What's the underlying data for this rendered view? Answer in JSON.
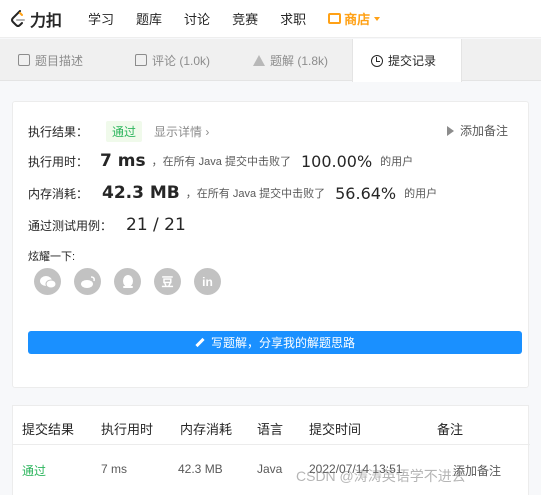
{
  "nav": {
    "brand": "力扣",
    "items": [
      "学习",
      "题库",
      "讨论",
      "竞赛",
      "求职"
    ],
    "store": "商店"
  },
  "tabs": [
    {
      "label": "题目描述",
      "icon": "document-icon"
    },
    {
      "label": "评论 (1.0k)",
      "icon": "comment-icon"
    },
    {
      "label": "题解 (1.8k)",
      "icon": "flask-icon"
    },
    {
      "label": "提交记录",
      "icon": "clock-icon",
      "active": true
    }
  ],
  "result": {
    "status_label": "执行结果：",
    "status_value": "通过",
    "show_detail": "显示详情 ›",
    "add_note": "添加备注",
    "runtime_label": "执行用时：",
    "runtime_value": "7 ms",
    "runtime_beat_text": "，在所有 Java 提交中击败了",
    "runtime_pct": "100.00%",
    "runtime_suffix": "的用户",
    "memory_label": "内存消耗：",
    "memory_value": "42.3 MB",
    "memory_beat_text": "，在所有 Java 提交中击败了",
    "memory_pct": "56.64%",
    "memory_suffix": "的用户",
    "tests_label": "通过测试用例：",
    "tests_value": "21 / 21",
    "share_label": "炫耀一下:",
    "share_icons": [
      "wechat-icon",
      "weibo-icon",
      "qq-icon",
      "douban-icon",
      "linkedin-icon"
    ],
    "douban_glyph": "豆",
    "linkedin_glyph": "in",
    "write_button": "写题解，分享我的解题思路"
  },
  "table": {
    "headers": [
      "提交结果",
      "执行用时",
      "内存消耗",
      "语言",
      "提交时间",
      "备注"
    ],
    "rows": [
      {
        "result": "通过",
        "time": "7 ms",
        "memory": "42.3 MB",
        "lang": "Java",
        "submitted": "2022/07/14 13:51",
        "note": "添加备注"
      }
    ]
  },
  "watermark": "CSDN @涛涛英语学不进去",
  "colors": {
    "accent": "#1a90ff",
    "success": "#2db55d",
    "store": "#ffa116"
  }
}
